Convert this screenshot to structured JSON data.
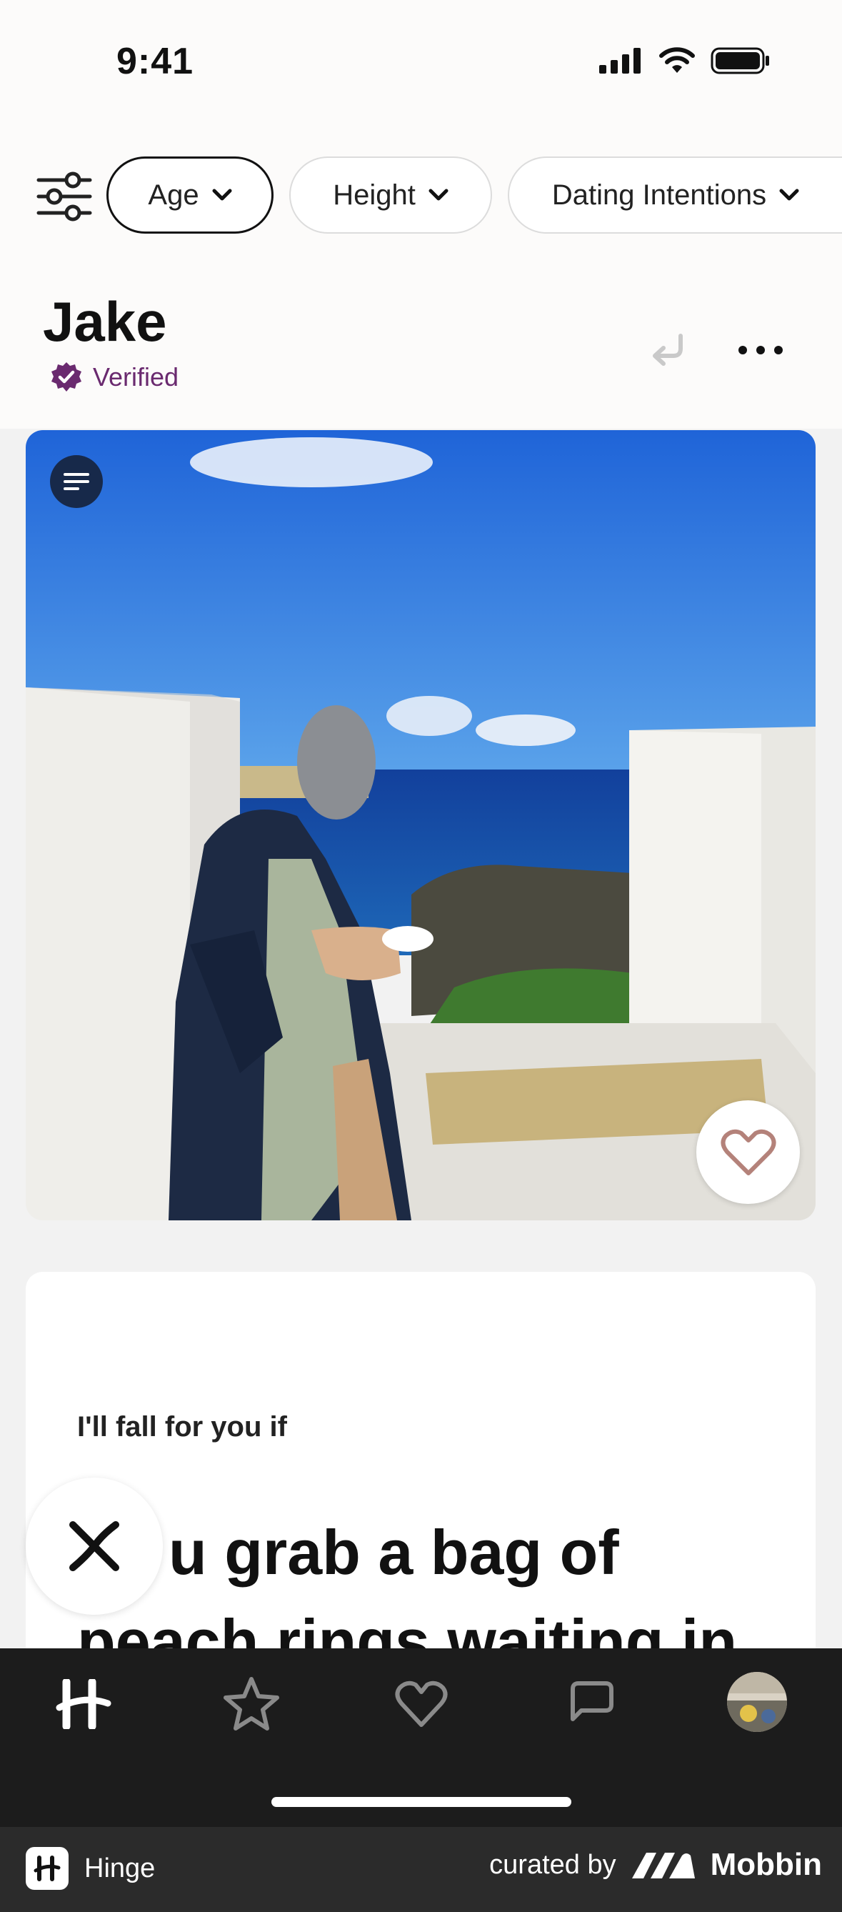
{
  "status_bar": {
    "time": "9:41"
  },
  "filters": {
    "chips": [
      {
        "label": "Age",
        "active": true
      },
      {
        "label": "Height",
        "active": false
      },
      {
        "label": "Dating Intentions",
        "active": false
      }
    ]
  },
  "profile": {
    "name": "Jake",
    "verified_label": "Verified"
  },
  "prompt": {
    "question": "I'll fall for you if",
    "answer_line1": "u grab a bag of",
    "answer_line2": "peach rings waiting in"
  },
  "tabs": [
    "discover",
    "standouts",
    "likes",
    "matches",
    "profile"
  ],
  "footer": {
    "app_name": "Hinge",
    "curated_by": "curated by",
    "brand": "Mobbin"
  },
  "colors": {
    "verified_purple": "#6a2a6f",
    "tab_bar": "#1c1c1c",
    "caption_button": "#17294a"
  }
}
